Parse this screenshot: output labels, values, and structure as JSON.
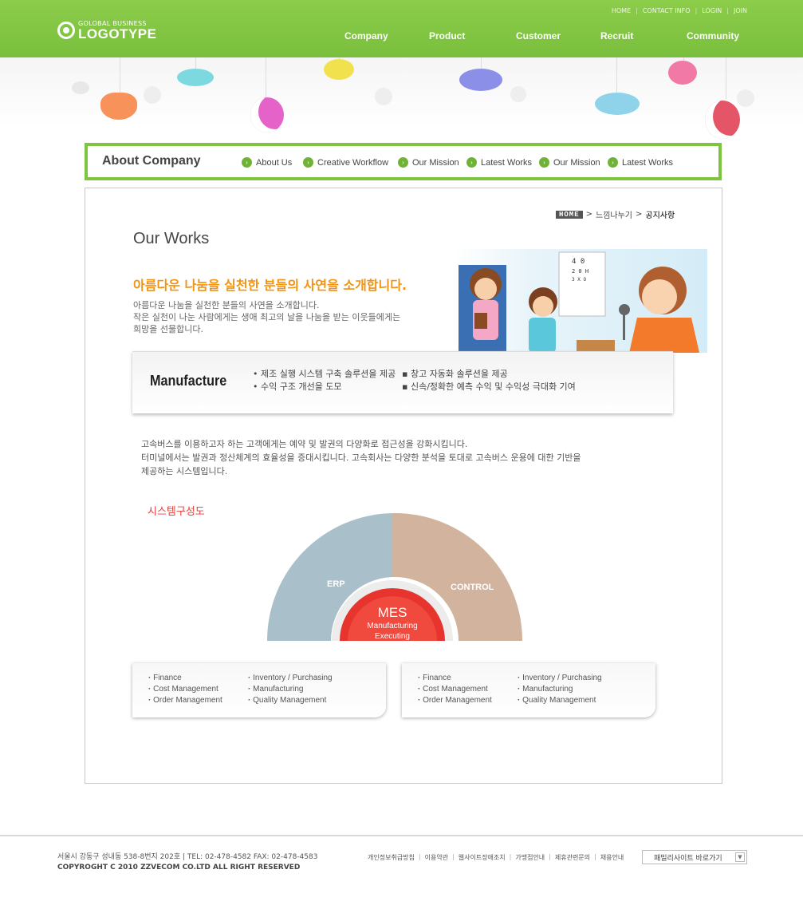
{
  "header": {
    "logo_sub": "GOLOBAL BUSINESS",
    "logo_main": "LOGOTYPE",
    "util": [
      "HOME",
      "CONTACT INFO",
      "LOGIN",
      "JOIN"
    ],
    "nav": [
      "Company",
      "Product",
      "Customer",
      "Recruit",
      "Community"
    ]
  },
  "subnav": {
    "title": "About Company",
    "items": [
      "About Us",
      "Creative Workflow",
      "Our Mission",
      "Latest Works",
      "Our Mission",
      "Latest Works"
    ]
  },
  "breadcrumb": {
    "home": "HOME",
    "sep": ">",
    "path1": "느낌나누기",
    "path2": "공지사항"
  },
  "main": {
    "title": "Our Works",
    "headline": "아름다운 나눔을 실천한 분들의 사연을 소개합니다.",
    "intro": [
      "아름다운 나눔을 실천한 분들의 사연을 소개합니다.",
      "작은 실천이 나눈 사람에게는 생애 최고의 날을 나눔을 받는 이웃들에게는",
      "희망을 선물합니다."
    ]
  },
  "manufacture": {
    "title": "Manufacture",
    "col1": [
      "• 제조 실행 시스템 구축 솔루션을 제공",
      "• 수익 구조 개선을 도모"
    ],
    "col2": [
      "▪   창고 자동화 솔루션을 제공",
      "▪    신속/정확한 예측 수익 및 수익성 극대화 기여"
    ]
  },
  "description": [
    "고속버스를 이용하고자 하는 고객에게는 예약 및 발권의 다양화로 접근성을 강화시킵니다.",
    "터미널에서는 발권과 정산체계의 효율성을 증대시킵니다. 고속회사는 다양한 분석을 토대로 고속버스 운용에 대한 기반을",
    "제공하는 시스템입니다."
  ],
  "system": {
    "label": "시스템구성도",
    "left": "ERP",
    "right": "CONTROL",
    "center": "MES",
    "center_sub1": "Manufacturing",
    "center_sub2": "Executing",
    "colors": {
      "left": "#a9bfca",
      "right": "#d2b39d",
      "center": "#e8342f"
    }
  },
  "boxes": [
    {
      "col1": [
        "Finance",
        "Cost Management",
        "Order Management"
      ],
      "col2": [
        "Inventory / Purchasing",
        "Manufacturing",
        "Quality Management"
      ]
    },
    {
      "col1": [
        "Finance",
        "Cost Management",
        "Order Management"
      ],
      "col2": [
        "Inventory / Purchasing",
        "Manufacturing",
        "Quality Management"
      ]
    }
  ],
  "footer": {
    "address": "서울시 강동구 성내동 538-8번지 202호 | TEL: 02-478-4582  FAX: 02-478-4583",
    "copyright": "COPYROGHT C 2010 ZZVECOM CO.LTD   ALL RIGHT RESERVED",
    "links": [
      "개인정보취급방침",
      "이용약관",
      "웹사이트장애조치",
      "가맹점안내",
      "제휴관련문의",
      "채용안내"
    ],
    "family": "패밀리사이트 바로가기"
  }
}
